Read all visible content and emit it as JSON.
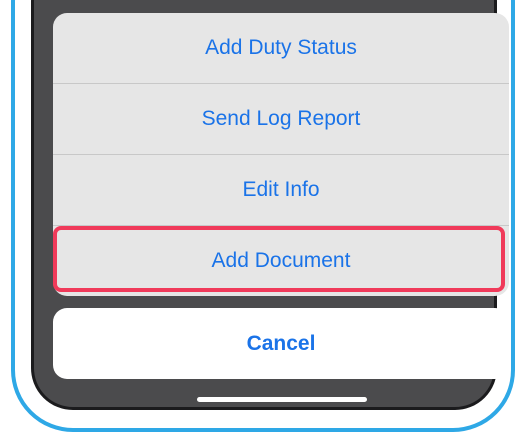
{
  "action_sheet": {
    "items": [
      {
        "label": "Add Duty Status"
      },
      {
        "label": "Send Log Report"
      },
      {
        "label": "Edit Info"
      },
      {
        "label": "Add Document"
      }
    ],
    "highlighted_index": 3,
    "highlight_color": "#f03a5a",
    "text_color": "#1a73e8"
  },
  "cancel": {
    "label": "Cancel"
  },
  "colors": {
    "frame": "#2ea8e6",
    "screen": "#4b4b4d",
    "sheet_background": "#e6e6e6"
  }
}
